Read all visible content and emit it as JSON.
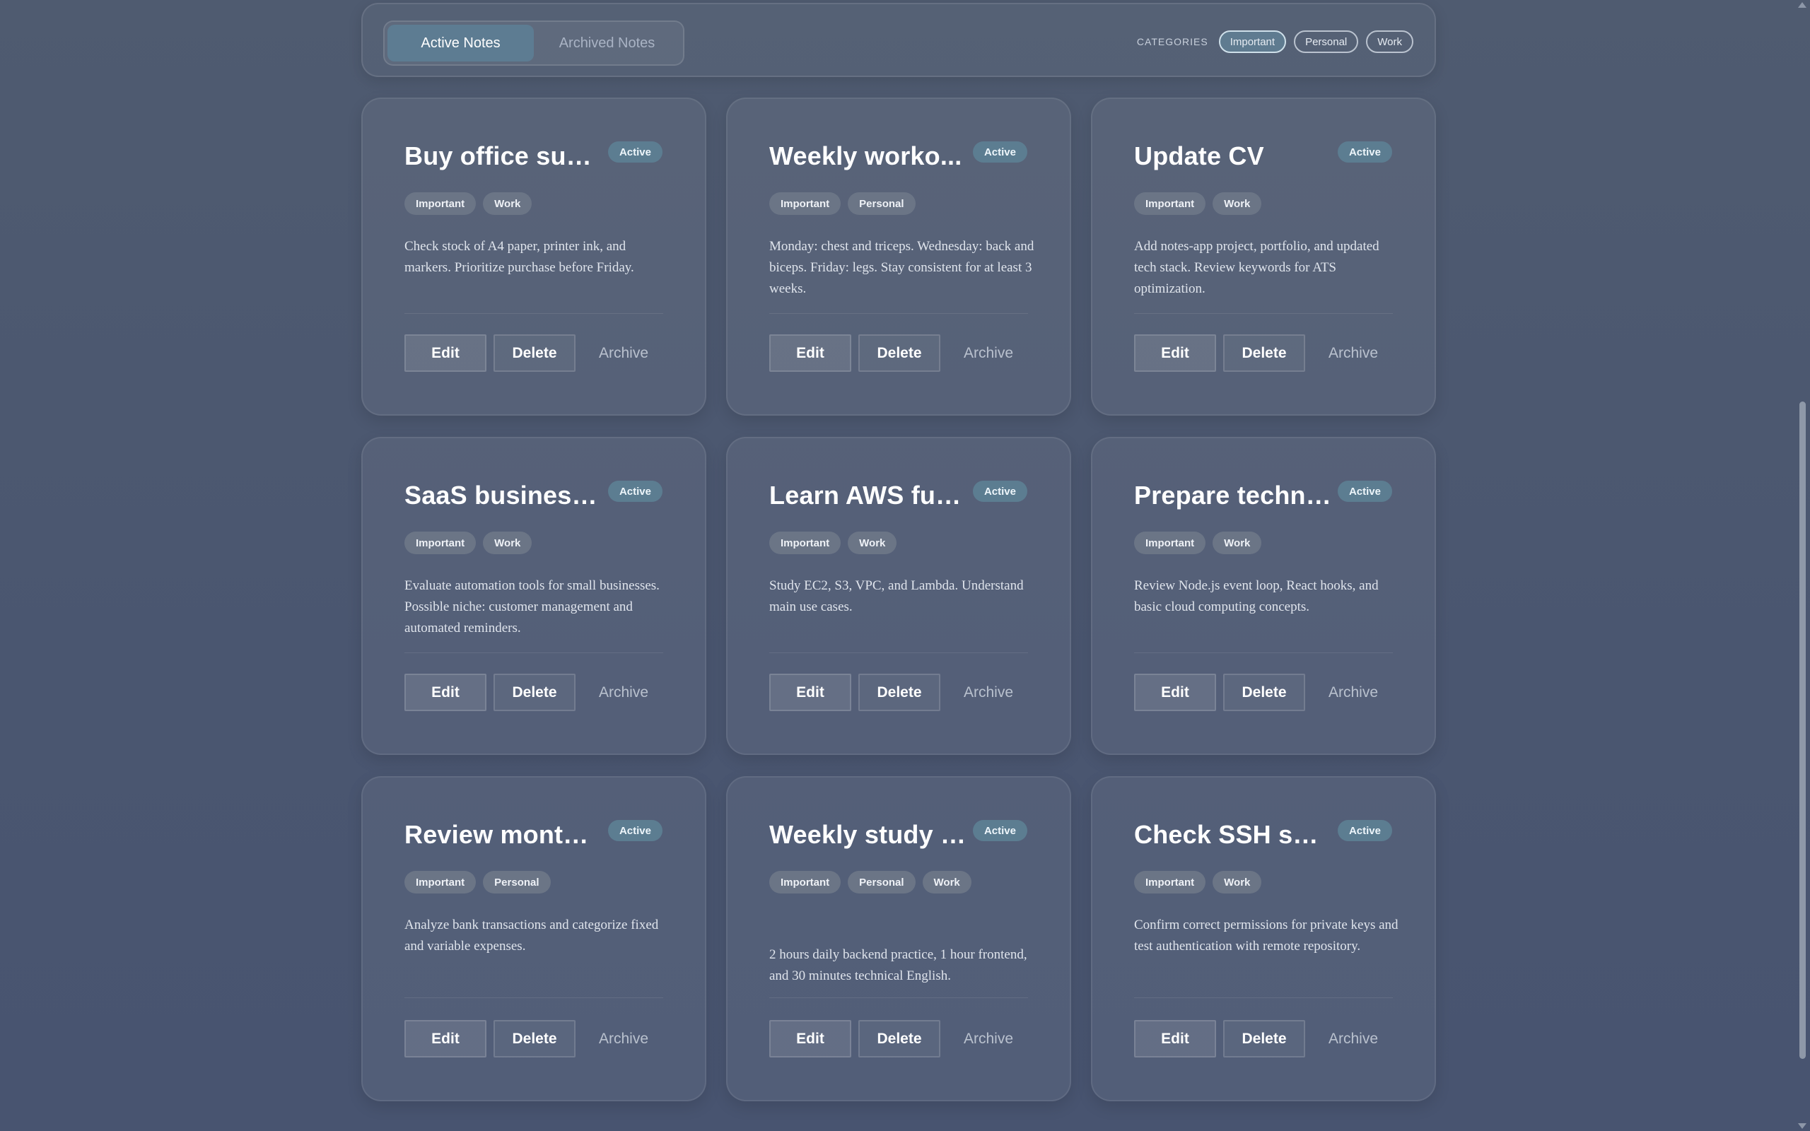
{
  "tabs": [
    {
      "label": "Active Notes",
      "active": true
    },
    {
      "label": "Archived Notes",
      "active": false
    }
  ],
  "categories": {
    "label": "CATEGORIES",
    "items": [
      {
        "label": "Important",
        "selected": true
      },
      {
        "label": "Personal",
        "selected": false
      },
      {
        "label": "Work",
        "selected": false
      }
    ]
  },
  "actions": {
    "edit": "Edit",
    "delete": "Delete",
    "archive": "Archive"
  },
  "notes": [
    {
      "title": "Buy office sup...",
      "status": "Active",
      "tags": [
        "Important",
        "Work"
      ],
      "body": "Check stock of A4 paper, printer ink, and markers. Prioritize purchase before Friday."
    },
    {
      "title": "Weekly worko...",
      "status": "Active",
      "tags": [
        "Important",
        "Personal"
      ],
      "body": "Monday: chest and triceps. Wednesday: back and biceps. Friday: legs. Stay consistent for at least 3 weeks."
    },
    {
      "title": "Update CV",
      "status": "Active",
      "tags": [
        "Important",
        "Work"
      ],
      "body": "Add notes-app project, portfolio, and updated tech stack. Review keywords for ATS optimization."
    },
    {
      "title": "SaaS business i...",
      "status": "Active",
      "tags": [
        "Important",
        "Work"
      ],
      "body": "Evaluate automation tools for small businesses. Possible niche: customer management and automated reminders."
    },
    {
      "title": "Learn AWS fun...",
      "status": "Active",
      "tags": [
        "Important",
        "Work"
      ],
      "body": "Study EC2, S3, VPC, and Lambda. Understand main use cases."
    },
    {
      "title": "Prepare techni...",
      "status": "Active",
      "tags": [
        "Important",
        "Work"
      ],
      "body": "Review Node.js event loop, React hooks, and basic cloud computing concepts."
    },
    {
      "title": "Review monthl...",
      "status": "Active",
      "tags": [
        "Important",
        "Personal"
      ],
      "body": "Analyze bank transactions and categorize fixed and variable expenses."
    },
    {
      "title": "Weekly study p...",
      "status": "Active",
      "tags": [
        "Important",
        "Personal",
        "Work"
      ],
      "body": "2 hours daily backend practice, 1 hour frontend, and 30 minutes technical English."
    },
    {
      "title": "Check SSH sec...",
      "status": "Active",
      "tags": [
        "Important",
        "Work"
      ],
      "body": "Confirm correct permissions for private keys and test authentication with remote repository."
    }
  ]
}
